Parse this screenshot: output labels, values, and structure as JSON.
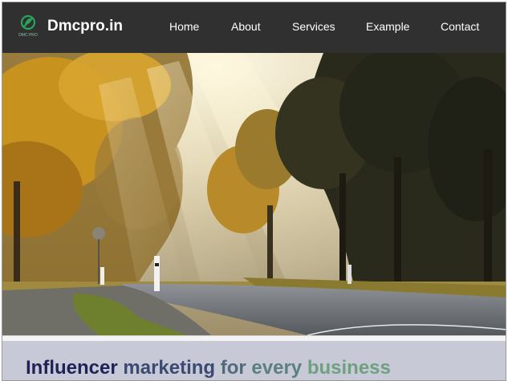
{
  "brand": {
    "name": "Dmcpro.in",
    "logo_caption": "DMC PRO",
    "accent": "#27a35a"
  },
  "nav": {
    "items": [
      {
        "label": "Home"
      },
      {
        "label": "About"
      },
      {
        "label": "Services"
      },
      {
        "label": "Example"
      },
      {
        "label": "Contact"
      }
    ]
  },
  "hero": {
    "image": "misty autumn road with trees and sun rays"
  },
  "headline": {
    "words": [
      "Influencer",
      "marketing",
      "for",
      "every",
      "business"
    ]
  }
}
